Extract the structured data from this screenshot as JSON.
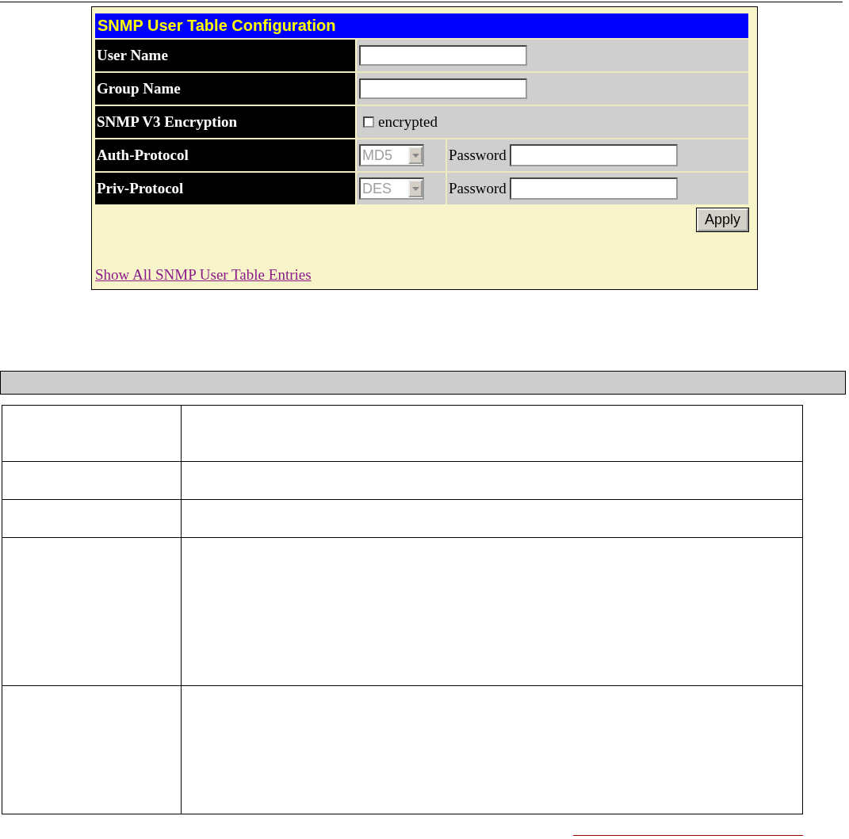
{
  "panel": {
    "title": "SNMP User Table Configuration",
    "rows": [
      {
        "kind": "text",
        "label": "User Name"
      },
      {
        "kind": "text",
        "label": "Group Name"
      },
      {
        "kind": "checkbox",
        "label": "SNMP V3 Encryption",
        "option": "encrypted",
        "checked": false
      },
      {
        "kind": "select",
        "label": "Auth-Protocol",
        "value": "MD5",
        "disabled": true,
        "password_label": "Password"
      },
      {
        "kind": "select",
        "label": "Priv-Protocol",
        "value": "DES",
        "disabled": true,
        "password_label": "Password"
      }
    ],
    "apply": "Apply",
    "link": "Show All SNMP User Table Entries"
  }
}
